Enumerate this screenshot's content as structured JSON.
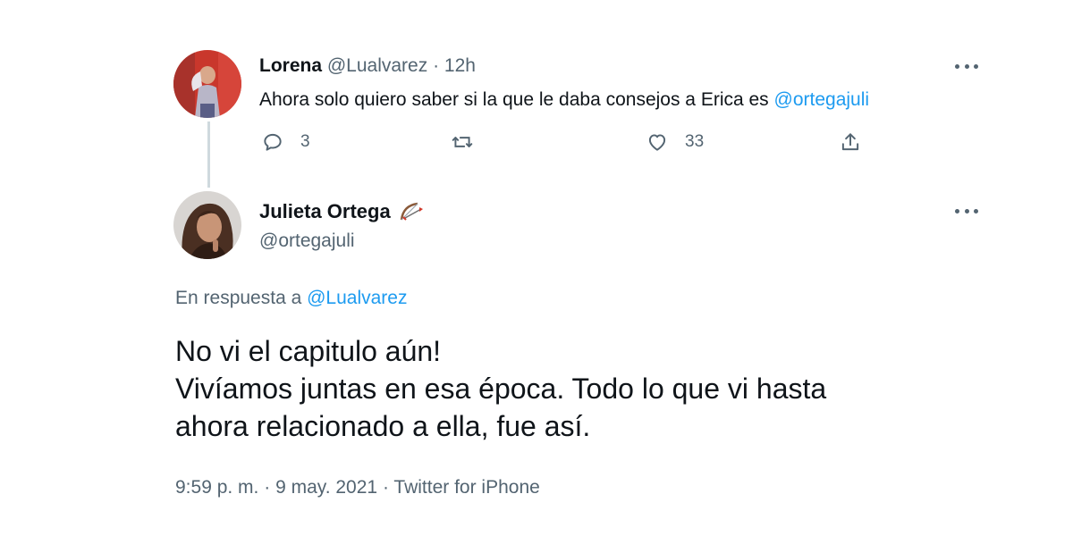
{
  "parent_tweet": {
    "display_name": "Lorena",
    "handle": "@Lualvarez",
    "separator": "·",
    "time": "12h",
    "text_before": "Ahora solo quiero saber si la que le daba consejos a Erica es ",
    "mention": "@ortegajuli",
    "actions": {
      "reply_icon": "reply-bubble-icon",
      "reply_count": "3",
      "retweet_icon": "retweet-icon",
      "like_icon": "heart-icon",
      "like_count": "33",
      "share_icon": "share-icon"
    },
    "more_icon": "more-dots-icon"
  },
  "reply_tweet": {
    "display_name": "Julieta Ortega",
    "name_emoji_icon": "bow-and-arrow-emoji-icon",
    "handle": "@ortegajuli",
    "more_icon": "more-dots-icon",
    "in_reply_prefix": "En respuesta a ",
    "in_reply_mention": "@Lualvarez",
    "text_lines": [
      "No vi el capitulo aún!",
      "Vivíamos juntas en esa época. Todo lo que vi hasta",
      "ahora relacionado a ella, fue así."
    ],
    "time": "9:59 p. m.",
    "date": "9 may. 2021",
    "source": "Twitter for iPhone",
    "separator": "·"
  },
  "colors": {
    "accent": "#1d9bf0",
    "text": "#0f1419",
    "muted": "#536471",
    "thread_line": "#cfd9de"
  }
}
